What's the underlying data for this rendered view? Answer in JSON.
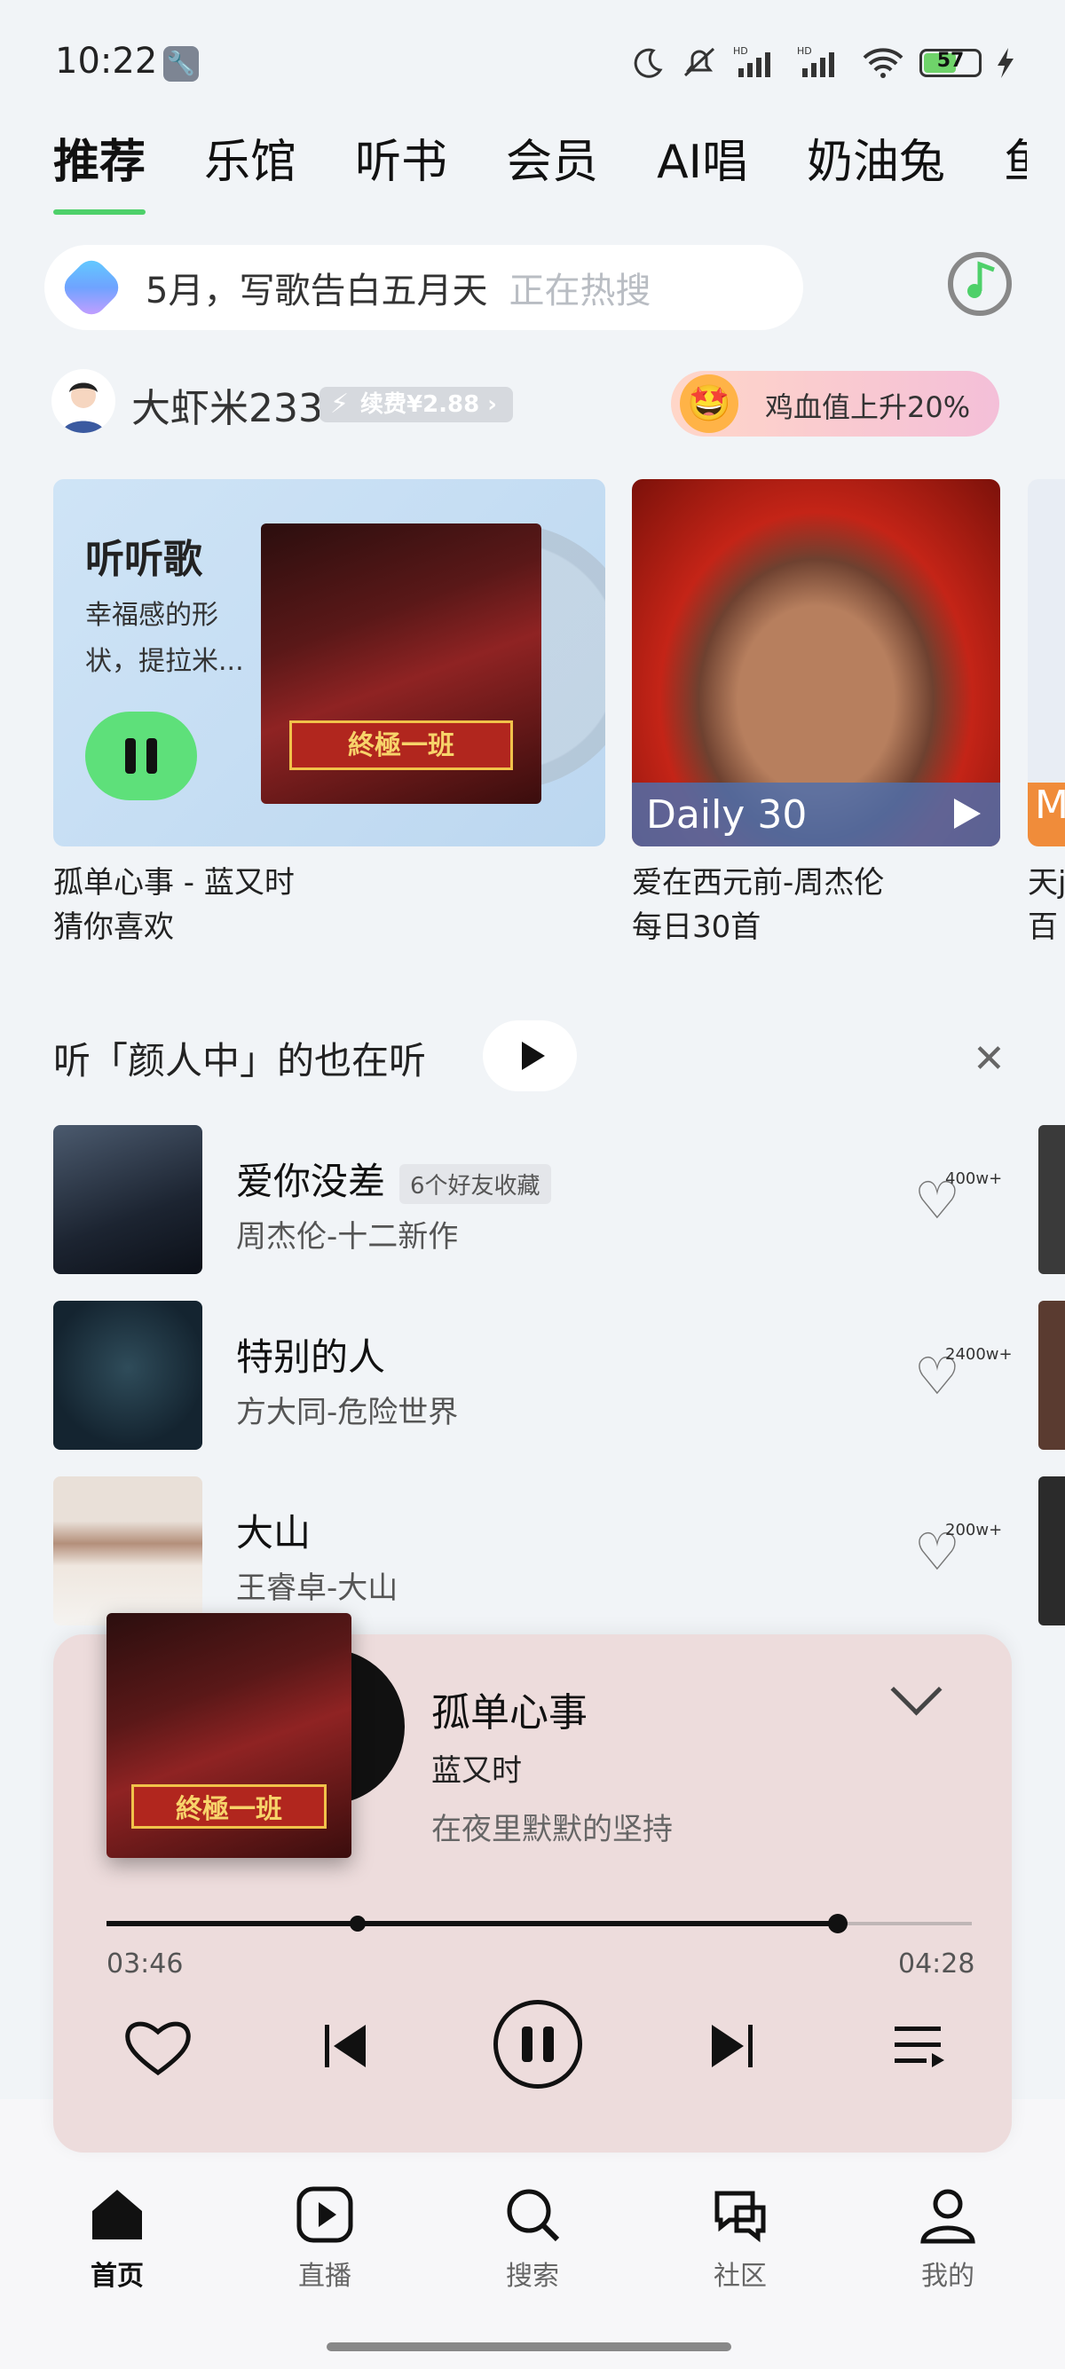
{
  "status_bar": {
    "time": "10:22",
    "battery": "57"
  },
  "tabs": [
    {
      "label": "推荐",
      "active": true
    },
    {
      "label": "乐馆"
    },
    {
      "label": "听书"
    },
    {
      "label": "会员"
    },
    {
      "label": "AI唱"
    },
    {
      "label": "奶油兔"
    },
    {
      "label": "鱼"
    }
  ],
  "search": {
    "text": "5月，写歌告白五月天",
    "hot_label": "正在热搜"
  },
  "user": {
    "name": "大虾米233",
    "renew_label": "续费¥2.88",
    "promo": "鸡血值上升20%"
  },
  "cards": [
    {
      "title": "听听歌",
      "desc": "幸福感的形状，提拉米...",
      "cover_text": "終極一班",
      "caption1": "孤单心事 - 蓝又时",
      "caption2": "猜你喜欢"
    },
    {
      "label": "Daily 30",
      "caption1": "爱在西元前-周杰伦",
      "caption2": "每日30首"
    },
    {
      "label": "M",
      "caption1": "天j",
      "caption2": "百"
    }
  ],
  "section": {
    "title": "听「颜人中」的也在听"
  },
  "songs": [
    {
      "title": "爱你没差",
      "badge": "6个好友收藏",
      "subtitle": "周杰伦-十二新作",
      "count": "400w+"
    },
    {
      "title": "特别的人",
      "badge": "",
      "subtitle": "方大同-危险世界",
      "count": "2400w+"
    },
    {
      "title": "大山",
      "badge": "",
      "subtitle": "王睿卓-大山",
      "count": "200w+"
    }
  ],
  "player": {
    "title": "孤单心事",
    "artist": "蓝又时",
    "lyric": "在夜里默默的坚持",
    "current_time": "03:46",
    "total_time": "04:28",
    "progress": 0.845,
    "cover_text": "終極一班"
  },
  "nav": [
    {
      "label": "首页",
      "active": true
    },
    {
      "label": "直播"
    },
    {
      "label": "搜索"
    },
    {
      "label": "社区"
    },
    {
      "label": "我的"
    }
  ],
  "colors": {
    "accent": "#4ed06a",
    "player_bg": "#eddcdc"
  }
}
